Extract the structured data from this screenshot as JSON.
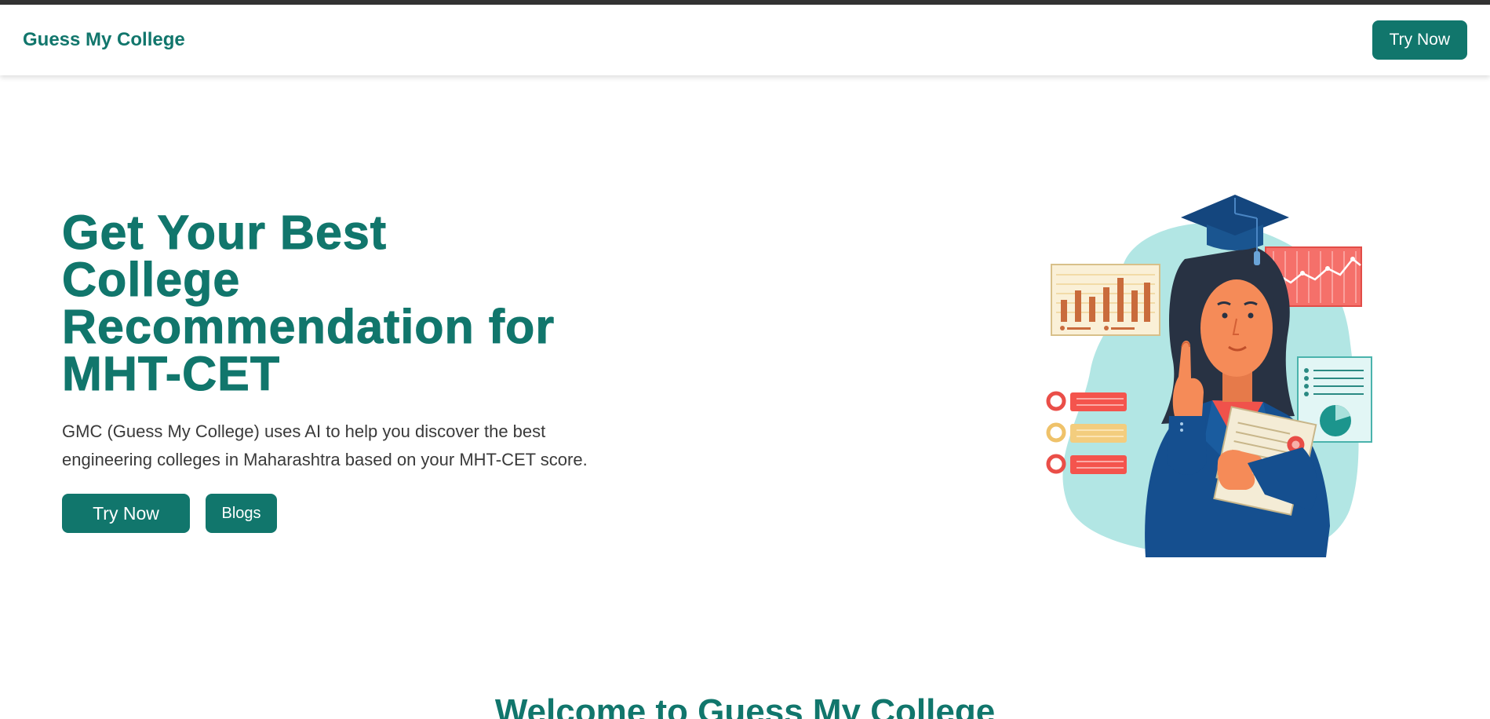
{
  "navbar": {
    "brand": "Guess My College",
    "cta_label": "Try Now"
  },
  "hero": {
    "title_lines": [
      "Get Your Best",
      "College",
      "Recommendation for",
      "MHT-CET"
    ],
    "description": "GMC (Guess My College) uses AI to help you discover the best engineering colleges in Maharashtra based on your MHT-CET score.",
    "primary_label": "Try Now",
    "secondary_label": "Blogs"
  },
  "section": {
    "welcome_title": "Welcome to Guess My College"
  },
  "colors": {
    "brand": "#11766c",
    "text": "#3a3a3a",
    "top_strip": "#333333"
  },
  "icons": {
    "illustration": "graduate-student-illustration"
  }
}
